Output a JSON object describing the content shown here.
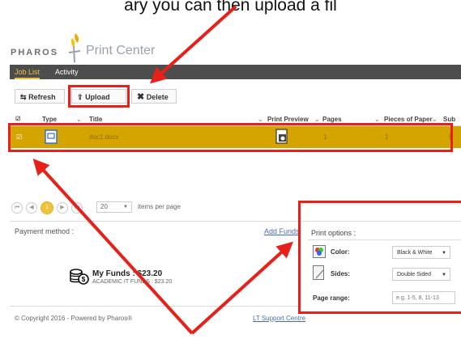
{
  "caption": "ary you can then upload a fil",
  "header": {
    "brand": "PHAROS",
    "product": "Print Center"
  },
  "nav": {
    "tabs": [
      {
        "label": "Job List"
      },
      {
        "label": "Activity"
      }
    ]
  },
  "toolbar": {
    "refresh_label": "Refresh",
    "upload_label": "Upload",
    "delete_label": "Delete"
  },
  "grid": {
    "columns": [
      "Type",
      "Title",
      "Print Preview",
      "Pages",
      "Pieces of Paper",
      "Sub"
    ],
    "rows": [
      {
        "title": "doc1.docx",
        "pages": "1",
        "pieces": "1",
        "sub": "$"
      }
    ]
  },
  "pager": {
    "first": "⏮",
    "prev": "◀",
    "page": "1",
    "next": "▶",
    "last": "⏭",
    "per_page": "20",
    "per_page_label": "items per page"
  },
  "payment": {
    "label": "Payment method :",
    "add_funds": "Add Funds",
    "funds_title": "My Funds : $23.20",
    "funds_sub": "ACADEMIC IT FUNDS : $23.20"
  },
  "options": {
    "title": "Print options :",
    "color_label": "Color:",
    "color_value": "Black & White",
    "sides_label": "Sides:",
    "sides_value": "Double Sided",
    "range_label": "Page range:",
    "range_placeholder": "e.g. 1-5, 8, 11-13"
  },
  "footer": {
    "copyright": "© Copyright 2016 - Powered by Pharos®",
    "support": "LT Support Centre"
  },
  "colors": {
    "accent": "#f0c23c",
    "annotation": "#e8201a",
    "nav_bg": "#4d4d4d",
    "row_bg": "#d4a500"
  }
}
